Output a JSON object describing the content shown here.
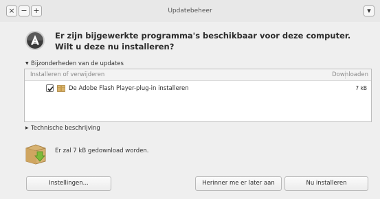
{
  "window": {
    "title": "Updatebeheer",
    "controls": {
      "close": "×",
      "minimize": "−",
      "maximize": "+",
      "menu": "▾"
    }
  },
  "header": {
    "question": "Er zijn bijgewerkte programma's beschikbaar voor deze computer. Wilt u deze nu installeren?",
    "icon": "software-update-icon"
  },
  "details": {
    "expander_label": "Bijzonderheden van de updates",
    "expanded": true,
    "columns": {
      "name": "Installeren of verwijderen",
      "download": "Downloaden"
    },
    "items": [
      {
        "label": "De Adobe Flash Player-plug-in installeren",
        "size": "7 kB",
        "checked": true,
        "icon": "package-icon"
      }
    ]
  },
  "technical": {
    "expander_label": "Technische beschrijving",
    "expanded": false
  },
  "summary": {
    "text": "Er zal 7 kB gedownload worden.",
    "icon": "download-box-icon"
  },
  "buttons": {
    "settings": "Instellingen...",
    "remind_later": "Herinner me er later aan",
    "install_now": "Nu installeren"
  },
  "colors": {
    "window_bg": "#efefef",
    "list_bg": "#ffffff",
    "accent_green": "#7cba3a"
  }
}
